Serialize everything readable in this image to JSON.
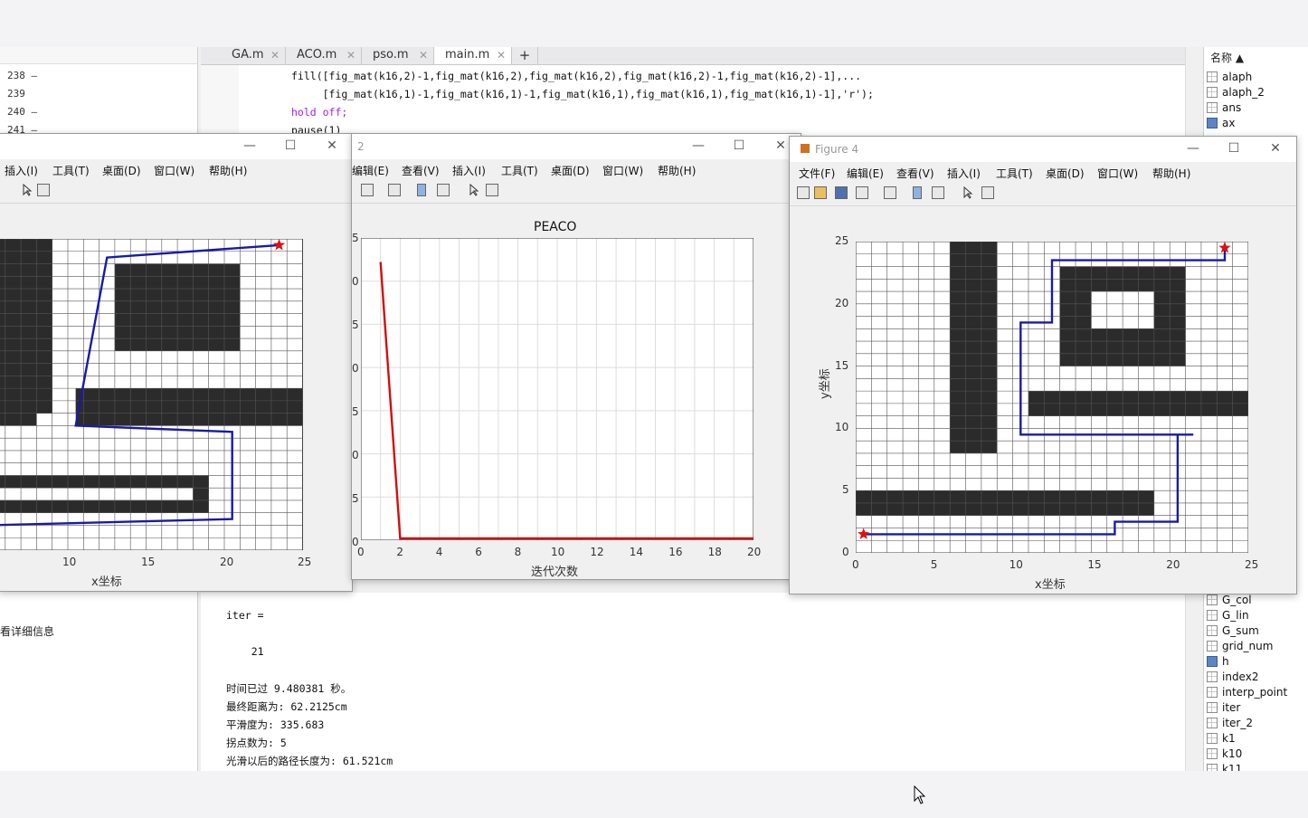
{
  "editor": {
    "tabs": [
      {
        "label": "GA.m"
      },
      {
        "label": "ACO.m"
      },
      {
        "label": "pso.m"
      },
      {
        "label": "main.m"
      }
    ],
    "tab_close": "✕",
    "tab_add": "+",
    "lines": [
      {
        "no": "238 —",
        "code": "fill([fig_mat(k16,2)-1,fig_mat(k16,2),fig_mat(k16,2),fig_mat(k16,2)-1,fig_mat(k16,2)-1],..."
      },
      {
        "no": "239",
        "code": "     [fig_mat(k16,1)-1,fig_mat(k16,1)-1,fig_mat(k16,1),fig_mat(k16,1),fig_mat(k16,1)-1],'r');"
      },
      {
        "no": "240 —",
        "code": "hold off;"
      },
      {
        "no": "241 —",
        "code": "pause(1)"
      }
    ]
  },
  "left_panel": {
    "detail_text": "看详细信息"
  },
  "command_window": {
    "lines": [
      "iter =",
      "",
      "    21",
      "",
      "时间已过 9.480381 秒。",
      "最终距离为: 62.2125cm",
      "平滑度为: 335.683",
      "拐点数为: 5",
      "光滑以后的路径长度为: 61.521cm"
    ]
  },
  "workspace": {
    "header": "名称 ▲",
    "top_items": [
      "alaph",
      "alaph_2",
      "ans",
      "ax"
    ],
    "bottom_items": [
      "G_col",
      "G_lin",
      "G_sum",
      "grid_num",
      "h",
      "index2",
      "interp_point",
      "iter",
      "iter_2",
      "k1",
      "k10",
      "k11"
    ]
  },
  "figures": {
    "fig_left": {
      "menus": [
        "插入(I)",
        "工具(T)",
        "桌面(D)",
        "窗口(W)",
        "帮助(H)"
      ],
      "xticks": [
        "10",
        "15",
        "20",
        "25"
      ],
      "xlabel": "x坐标"
    },
    "fig_mid": {
      "title_partial": "2",
      "menus": [
        "编辑(E)",
        "查看(V)",
        "插入(I)",
        "工具(T)",
        "桌面(D)",
        "窗口(W)",
        "帮助(H)"
      ],
      "plot_title": "PEACO",
      "xlabel": "迭代次数",
      "xticks": [
        "0",
        "2",
        "4",
        "6",
        "8",
        "10",
        "12",
        "14",
        "16",
        "18",
        "20"
      ],
      "yticks_partial": [
        "5",
        "0",
        "5",
        "0",
        "5",
        "0",
        "5",
        "0"
      ]
    },
    "fig_right": {
      "title": "Figure 4",
      "menus": [
        "文件(F)",
        "编辑(E)",
        "查看(V)",
        "插入(I)",
        "工具(T)",
        "桌面(D)",
        "窗口(W)",
        "帮助(H)"
      ],
      "xticks": [
        "0",
        "5",
        "10",
        "15",
        "20",
        "25"
      ],
      "yticks": [
        "0",
        "5",
        "10",
        "15",
        "20",
        "25"
      ],
      "xlabel": "x坐标",
      "ylabel": "y坐标"
    }
  },
  "window_controls": {
    "min": "—",
    "max": "☐",
    "close": "✕"
  },
  "colors": {
    "path": "#1a1aa6",
    "obstacle": "#2b2b2b",
    "curve": "#d01010",
    "star": "#e01010"
  },
  "chart_data": [
    {
      "type": "line",
      "title": "PEACO",
      "xlabel": "迭代次数",
      "ylabel": "",
      "xlim": [
        0,
        20
      ],
      "series": [
        {
          "x": [
            1,
            2,
            3,
            20
          ],
          "y": [
            0.92,
            0,
            0,
            0
          ]
        }
      ]
    }
  ]
}
